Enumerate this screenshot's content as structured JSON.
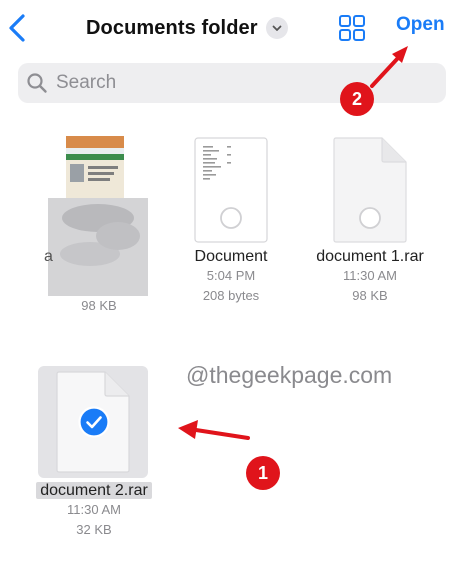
{
  "nav": {
    "back_icon": "chevron-left-icon",
    "title": "Documents folder",
    "title_menu_icon": "chevron-down-icon",
    "view_icon": "grid-icon",
    "open_label": "Open"
  },
  "search": {
    "placeholder": "Search",
    "value": ""
  },
  "files": [
    {
      "name": "a",
      "time": "",
      "size": "98 KB",
      "thumbnail": "id-card-photo-blurred",
      "selected": false
    },
    {
      "name": "Document",
      "time": "5:04 PM",
      "size": "208 bytes",
      "thumbnail": "text-document",
      "selected": false
    },
    {
      "name": "document 1.rar",
      "time": "11:30 AM",
      "size": "98 KB",
      "thumbnail": "blank-document",
      "selected": false
    },
    {
      "name": "document 2.rar",
      "time": "11:30 AM",
      "size": "32 KB",
      "thumbnail": "blank-document",
      "selected": true
    }
  ],
  "annotations": {
    "step1": "1",
    "step2": "2",
    "arrow_color": "#e0141b"
  },
  "watermark": "@thegeekpage.com",
  "colors": {
    "accent": "#1a7cf7",
    "selection": "#e3e3e6",
    "annotation": "#e0141b"
  }
}
